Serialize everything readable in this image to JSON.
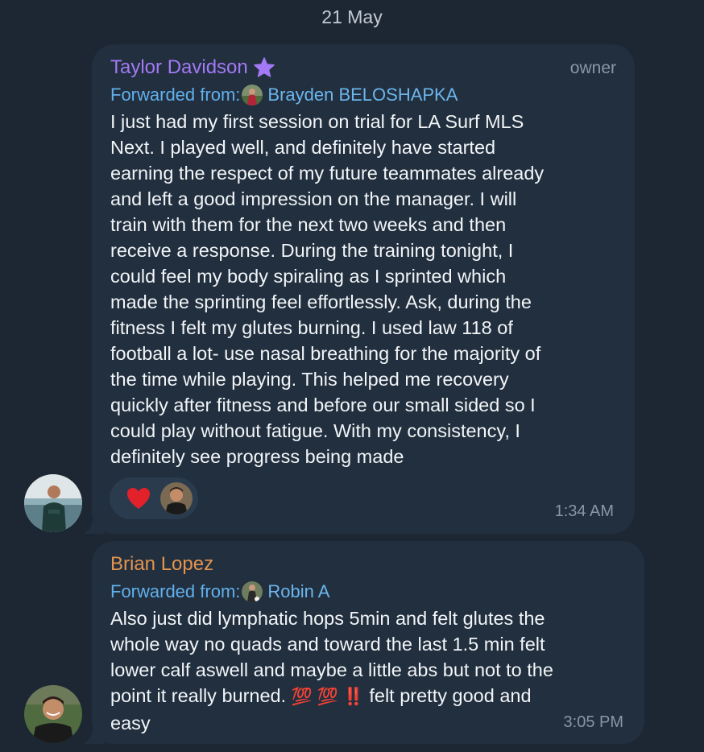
{
  "date_separator": "21 May",
  "messages": [
    {
      "sender": "Taylor Davidson",
      "sender_color": "#a379f5",
      "badge_icon": "star-icon",
      "role": "owner",
      "forwarded_label": "Forwarded from:",
      "forwarded_name": "Brayden BELOSHAPKA",
      "text": "I just had my first session on trial for LA Surf MLS\nNext. I played well, and definitely have started\nearning the respect of my future teammates already\nand left a good impression on the manager. I will\ntrain with them for the next two weeks and then\nreceive a response. During the training tonight, I\ncould feel my body spiraling as I sprinted which\nmade the sprinting feel effortlessly. Ask, during the\nfitness I felt my glutes burning. I used law 118 of\nfootball a lot- use nasal breathing for the majority of\nthe time while playing. This helped me recovery\nquickly after fitness and before our small sided so I\ncould play without fatigue. With my consistency, I\ndefinitely see progress being made",
      "reaction_icon": "heart-icon",
      "time": "1:34 AM"
    },
    {
      "sender": "Brian Lopez",
      "sender_color": "#e6934e",
      "forwarded_label": "Forwarded from:",
      "forwarded_name": "Robin A",
      "text_part1": "Also just did lymphatic hops 5min and felt glutes the\nwhole way no quads and toward the last 1.5 min felt\nlower calf aswell and maybe a little abs but not to the\npoint it really burned. ",
      "emojis": "💯 💯 ‼️",
      "text_part2": " felt pretty good and\neasy",
      "time": "3:05 PM"
    }
  ],
  "colors": {
    "background": "#1c2733",
    "bubble": "#212f3e",
    "link": "#62b0ec",
    "muted": "#8a96a3"
  }
}
